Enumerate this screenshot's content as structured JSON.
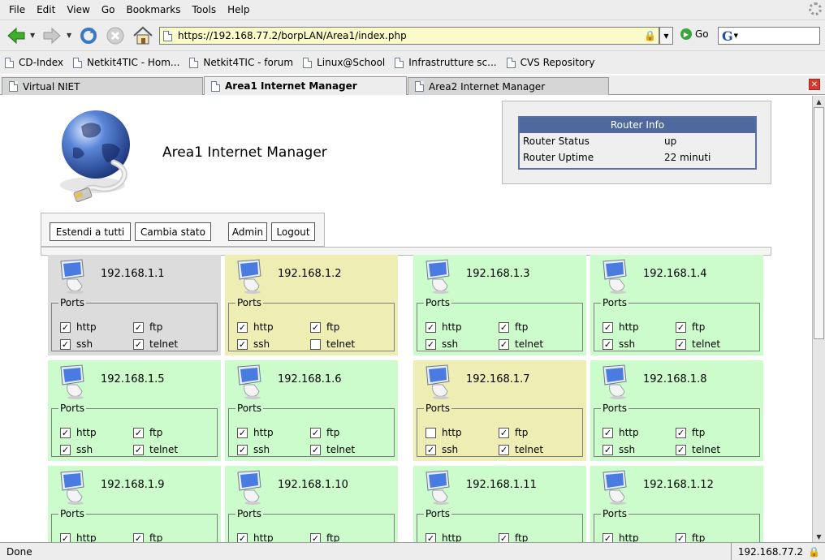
{
  "menu": [
    "File",
    "Edit",
    "View",
    "Go",
    "Bookmarks",
    "Tools",
    "Help"
  ],
  "toolbar": {
    "url": "https://192.168.77.2/borpLAN/Area1/index.php",
    "go_label": "Go",
    "search_placeholder": ""
  },
  "bookmarks": [
    "CD-Index",
    "Netkit4TIC - Hom...",
    "Netkit4TIC - forum",
    "Linux@School",
    "Infrastrutture sc...",
    "CVS Repository"
  ],
  "tabs": [
    "Virtual NIET",
    "Area1 Internet Manager",
    "Area2 Internet Manager"
  ],
  "status": {
    "text": "Done",
    "host": "192.168.77.2"
  },
  "page": {
    "title": "Area1 Internet Manager",
    "router_info": {
      "heading": "Router Info",
      "rows": [
        {
          "k": "Router Status",
          "v": "up"
        },
        {
          "k": "Router Uptime",
          "v": "22 minuti"
        }
      ]
    },
    "buttons": {
      "extend": "Estendi a tutti",
      "change": "Cambia stato",
      "admin": "Admin",
      "logout": "Logout"
    },
    "ports_label": "Ports",
    "port_names": {
      "http": "http",
      "ftp": "ftp",
      "ssh": "ssh",
      "telnet": "telnet"
    },
    "hosts": [
      {
        "ip": "192.168.1.1",
        "bg": "#dcdcdc",
        "http": true,
        "ftp": true,
        "ssh": true,
        "telnet": true
      },
      {
        "ip": "192.168.1.2",
        "bg": "#eeeeb4",
        "http": true,
        "ftp": true,
        "ssh": true,
        "telnet": false
      },
      {
        "ip": "192.168.1.3",
        "bg": "#ccfccc",
        "http": true,
        "ftp": true,
        "ssh": true,
        "telnet": true
      },
      {
        "ip": "192.168.1.4",
        "bg": "#ccfccc",
        "http": true,
        "ftp": true,
        "ssh": true,
        "telnet": true
      },
      {
        "ip": "192.168.1.5",
        "bg": "#ccfccc",
        "http": true,
        "ftp": true,
        "ssh": true,
        "telnet": true
      },
      {
        "ip": "192.168.1.6",
        "bg": "#ccfccc",
        "http": true,
        "ftp": true,
        "ssh": true,
        "telnet": true
      },
      {
        "ip": "192.168.1.7",
        "bg": "#eeeeb4",
        "http": false,
        "ftp": true,
        "ssh": true,
        "telnet": true
      },
      {
        "ip": "192.168.1.8",
        "bg": "#ccfccc",
        "http": true,
        "ftp": true,
        "ssh": true,
        "telnet": true
      },
      {
        "ip": "192.168.1.9",
        "bg": "#ccfccc",
        "http": true,
        "ftp": true,
        "ssh": null,
        "telnet": null
      },
      {
        "ip": "192.168.1.10",
        "bg": "#ccfccc",
        "http": true,
        "ftp": true,
        "ssh": null,
        "telnet": null
      },
      {
        "ip": "192.168.1.11",
        "bg": "#ccfccc",
        "http": true,
        "ftp": true,
        "ssh": null,
        "telnet": null
      },
      {
        "ip": "192.168.1.12",
        "bg": "#ccfccc",
        "http": true,
        "ftp": true,
        "ssh": null,
        "telnet": null
      }
    ]
  }
}
